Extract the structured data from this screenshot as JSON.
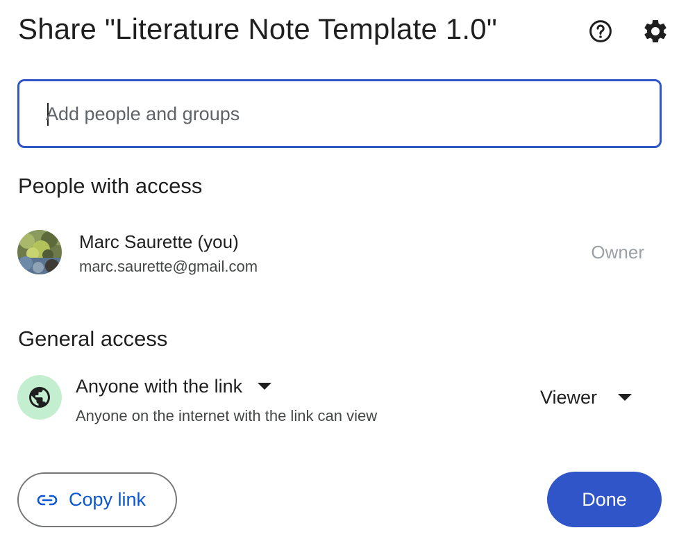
{
  "dialog": {
    "title": "Share \"Literature Note Template 1.0\"",
    "help_icon": "help-circle-icon",
    "settings_icon": "gear-icon"
  },
  "add_people": {
    "placeholder": "Add people and groups",
    "value": ""
  },
  "people_with_access": {
    "heading": "People with access",
    "people": [
      {
        "name": "Marc Saurette (you)",
        "email": "marc.saurette@gmail.com",
        "role": "Owner"
      }
    ]
  },
  "general_access": {
    "heading": "General access",
    "icon": "globe-icon",
    "scope_label": "Anyone with the link",
    "description": "Anyone on the internet with the link can view",
    "role_label": "Viewer"
  },
  "footer": {
    "copy_link_label": "Copy link",
    "done_label": "Done"
  },
  "colors": {
    "accent": "#2f55c8",
    "link_text": "#0b57d0",
    "globe_badge_bg": "#c4eed0",
    "muted_role": "#9aa0a6"
  }
}
